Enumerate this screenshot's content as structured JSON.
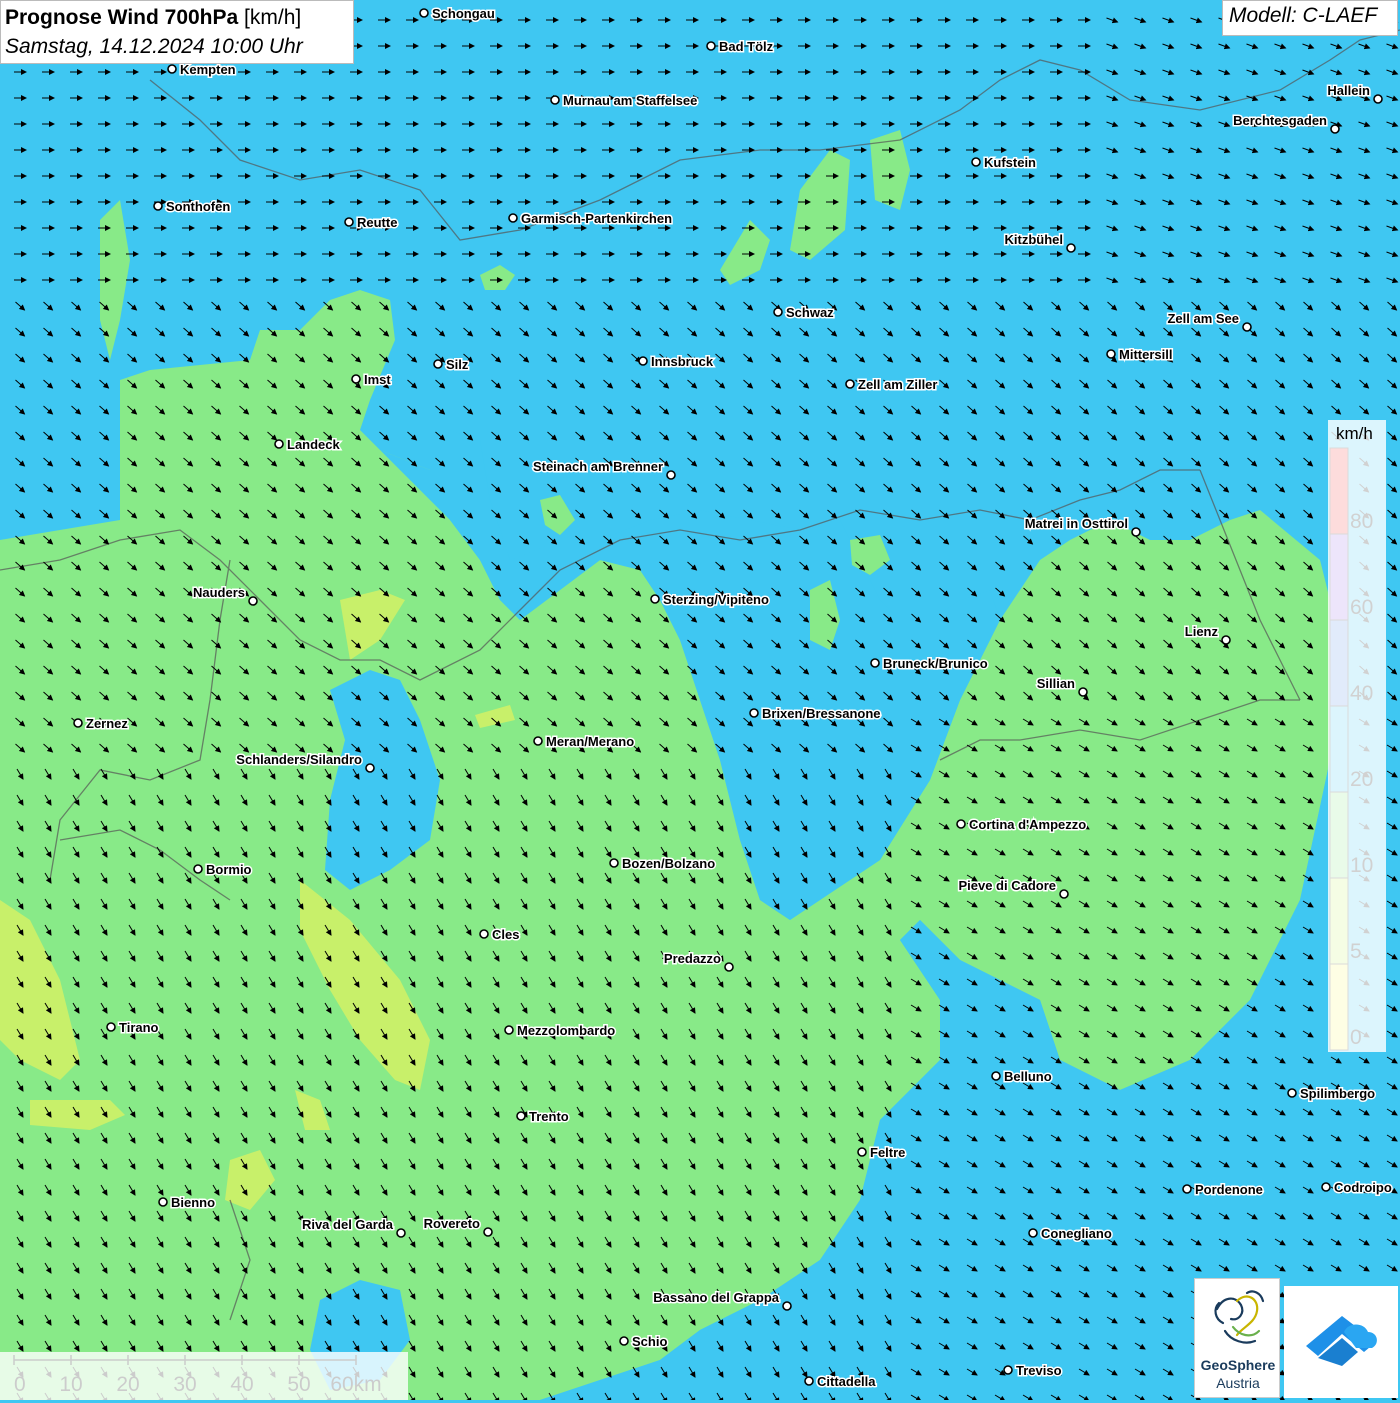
{
  "header": {
    "title": "Prognose Wind 700hPa",
    "unit": "[km/h]",
    "subtitle": "Samstag, 14.12.2024 10:00 Uhr",
    "model": "Modell: C-LAEF"
  },
  "legend": {
    "unit": "km/h",
    "labels": [
      "80",
      "60",
      "40",
      "20",
      "10",
      "5",
      "0"
    ],
    "colors": [
      "#f03c3c",
      "#9a6ee6",
      "#5a93ea",
      "#3fc7f2",
      "#88ea88",
      "#c8f06a",
      "#fafa6a"
    ]
  },
  "scalebar": {
    "ticks": [
      "0",
      "10",
      "20",
      "30",
      "40",
      "50",
      "60km"
    ]
  },
  "wind": {
    "direction": "north-west",
    "arrow_color": "#000000",
    "colors": {
      "zone_20_40": "#3fc7f2",
      "zone_10_20": "#88ea88",
      "zone_5_10": "#c8f06a"
    }
  },
  "cities": [
    {
      "name": "Schongau"
    },
    {
      "name": "Bad Tölz"
    },
    {
      "name": "Kempten"
    },
    {
      "name": "Murnau am Staffelsee"
    },
    {
      "name": "Hallein"
    },
    {
      "name": "Berchtesgaden"
    },
    {
      "name": "Kufstein"
    },
    {
      "name": "Sonthofen"
    },
    {
      "name": "Reutte"
    },
    {
      "name": "Garmisch-Partenkirchen"
    },
    {
      "name": "Kitzbühel"
    },
    {
      "name": "Schwaz"
    },
    {
      "name": "Zell am See"
    },
    {
      "name": "Mittersill"
    },
    {
      "name": "Innsbruck"
    },
    {
      "name": "Silz"
    },
    {
      "name": "Imst"
    },
    {
      "name": "Zell am Ziller"
    },
    {
      "name": "Landeck"
    },
    {
      "name": "Steinach am Brenner"
    },
    {
      "name": "Matrei in Osttirol"
    },
    {
      "name": "Nauders"
    },
    {
      "name": "Sterzing/Vipiteno"
    },
    {
      "name": "Lienz"
    },
    {
      "name": "Bruneck/Brunico"
    },
    {
      "name": "Sillian"
    },
    {
      "name": "Brixen/Bressanone"
    },
    {
      "name": "Zernez"
    },
    {
      "name": "Meran/Merano"
    },
    {
      "name": "Schlanders/Silandro"
    },
    {
      "name": "Cortina d'Ampezzo"
    },
    {
      "name": "Bozen/Bolzano"
    },
    {
      "name": "Bormio"
    },
    {
      "name": "Pieve di Cadore"
    },
    {
      "name": "Cles"
    },
    {
      "name": "Predazzo"
    },
    {
      "name": "Tirano"
    },
    {
      "name": "Mezzolombardo"
    },
    {
      "name": "Belluno"
    },
    {
      "name": "Spilimbergo"
    },
    {
      "name": "Trento"
    },
    {
      "name": "Feltre"
    },
    {
      "name": "Pordenone"
    },
    {
      "name": "Codroipo"
    },
    {
      "name": "Bienno"
    },
    {
      "name": "Riva del Garda"
    },
    {
      "name": "Rovereto"
    },
    {
      "name": "Conegliano"
    },
    {
      "name": "Bassano del Grappa"
    },
    {
      "name": "Schio"
    },
    {
      "name": "Treviso"
    },
    {
      "name": "Cittadella"
    }
  ],
  "logos": {
    "geosphere_line1": "GeoSphere",
    "geosphere_line2": "Austria"
  }
}
